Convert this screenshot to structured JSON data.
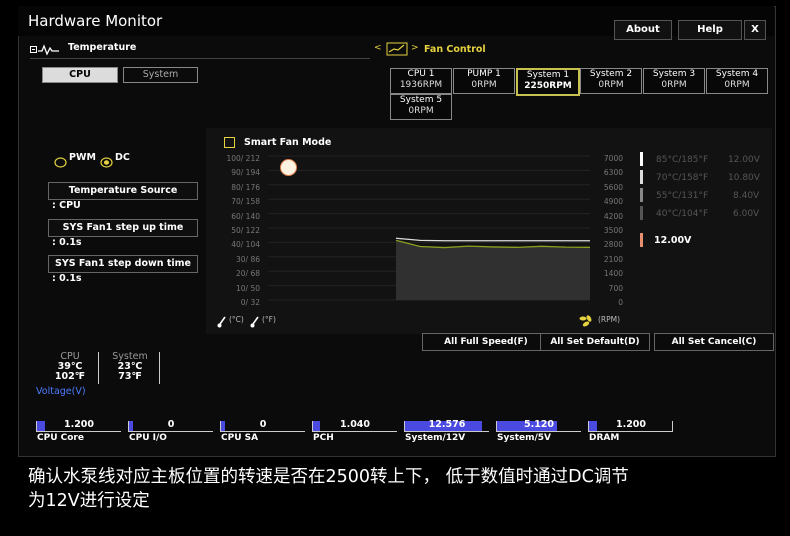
{
  "app": {
    "title": "Hardware Monitor",
    "buttons": {
      "about": "About",
      "help": "Help",
      "close": "X"
    }
  },
  "temperature": {
    "heading": "Temperature",
    "tabs": [
      {
        "label": "CPU",
        "selected": true
      },
      {
        "label": "System",
        "selected": false
      }
    ]
  },
  "fan_control": {
    "heading": "Fan Control",
    "nav_arrows": "< >",
    "fans": [
      {
        "name": "CPU 1",
        "rpm": "1936RPM",
        "selected": false
      },
      {
        "name": "PUMP 1",
        "rpm": "0RPM",
        "selected": false
      },
      {
        "name": "System 1",
        "rpm": "2250RPM",
        "selected": true
      },
      {
        "name": "System 2",
        "rpm": "0RPM",
        "selected": false
      },
      {
        "name": "System 3",
        "rpm": "0RPM",
        "selected": false
      },
      {
        "name": "System 4",
        "rpm": "0RPM",
        "selected": false
      },
      {
        "name": "System 5",
        "rpm": "0RPM",
        "selected": false
      }
    ]
  },
  "mode": {
    "pwm": "PWM",
    "dc": "DC",
    "selected": "DC"
  },
  "settings": {
    "temp_source_label": "Temperature Source",
    "temp_source_value": ": CPU",
    "step_up_label": "SYS Fan1 step up time",
    "step_up_value": ": 0.1s",
    "step_down_label": "SYS Fan1 step down time",
    "step_down_value": ": 0.1s"
  },
  "smart_fan": {
    "label": "Smart Fan Mode",
    "checked": false
  },
  "chart": {
    "left_ticks": [
      "100/ 212",
      "90/ 194",
      "80/ 176",
      "70/ 158",
      "60/ 140",
      "50/ 122",
      "40/ 104",
      "30/ 86",
      "20/ 68",
      "10/ 50",
      "0/ 32"
    ],
    "rpm_ticks": [
      "7000",
      "6300",
      "5600",
      "4900",
      "4200",
      "3500",
      "2800",
      "2100",
      "1400",
      "700",
      "0"
    ],
    "voltage_levels": [
      {
        "temp": "85°C/185°F",
        "volt": "12.00V"
      },
      {
        "temp": "70°C/158°F",
        "volt": "10.80V"
      },
      {
        "temp": "55°C/131°F",
        "volt": "8.40V"
      },
      {
        "temp": "40°C/104°F",
        "volt": "6.00V"
      }
    ],
    "current_voltage": "12.00V",
    "unit_c": "(°C)",
    "unit_f": "(°F)",
    "unit_rpm": "(RPM)"
  },
  "chart_data": {
    "type": "line",
    "x": [
      0,
      40,
      80,
      120,
      160,
      200,
      240,
      280,
      320
    ],
    "series": [
      {
        "values": [
          2900,
          2600,
          2550,
          2620,
          2580,
          2560,
          2610,
          2570,
          2560
        ],
        "color": "#8aa020"
      },
      {
        "values": [
          3000,
          2900,
          2880,
          2880,
          2880,
          2880,
          2880,
          2880,
          2880
        ],
        "color": "#dddddd"
      }
    ],
    "ylim": [
      0,
      7000
    ],
    "grid": true
  },
  "actions": {
    "full_speed": "All Full Speed(F)",
    "set_default": "All Set Default(D)",
    "set_cancel": "All Set Cancel(C)"
  },
  "readout": {
    "cpu_label": "CPU",
    "cpu_c": "39℃",
    "cpu_f": "102℉",
    "system_label": "System",
    "system_c": "23℃",
    "system_f": "73℉",
    "voltage_heading": "Voltage(V)"
  },
  "voltages": [
    {
      "name": "CPU Core",
      "value": "1.200",
      "level": 0.1
    },
    {
      "name": "CPU I/O",
      "value": "0",
      "level": 0
    },
    {
      "name": "CPU SA",
      "value": "0",
      "level": 0
    },
    {
      "name": "PCH",
      "value": "1.040",
      "level": 0.08
    },
    {
      "name": "System/12V",
      "value": "12.576",
      "level": 0.92
    },
    {
      "name": "System/5V",
      "value": "5.120",
      "level": 0.72
    },
    {
      "name": "DRAM",
      "value": "1.200",
      "level": 0.1
    }
  ],
  "caption": {
    "line1": "确认水泵线对应主板位置的转速是否在2500转上下， 低于数值时通过DC调节",
    "line2": "为12V进行设定"
  },
  "colors": {
    "accent_yellow": "#e6d240",
    "selected_border": "#c8c050",
    "bar_blue": "#4a4ae0",
    "curve_green": "#8aa020"
  }
}
